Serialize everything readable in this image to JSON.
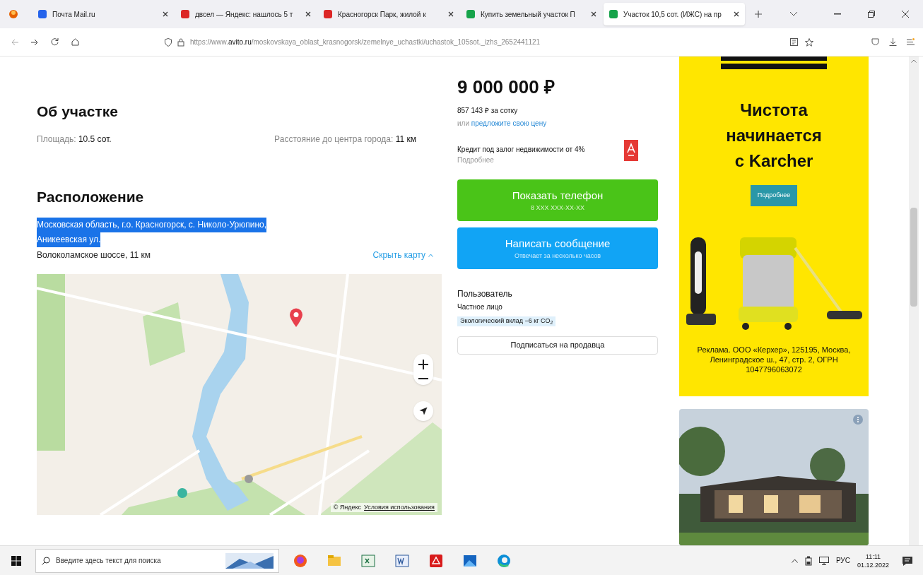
{
  "browser": {
    "tabs": [
      {
        "title": "Почта Mail.ru",
        "selected": false,
        "color": "#2563eb"
      },
      {
        "title": "двсел — Яндекс: нашлось 5 т",
        "selected": false,
        "color": "#dc2626"
      },
      {
        "title": "Красногорск Парк, жилой к",
        "selected": false,
        "color": "#dc2626"
      },
      {
        "title": "Купить земельный участок П",
        "selected": false,
        "color": "#16a34a"
      },
      {
        "title": "Участок 10,5 сот. (ИЖС) на пр",
        "selected": true,
        "color": "#16a34a"
      }
    ],
    "url_prefix": "https://www.",
    "url_domain": "avito.ru",
    "url_path": "/moskovskaya_oblast_krasnogorsk/zemelnye_uchastki/uchastok_105sot._izhs_2652441121"
  },
  "about": {
    "heading": "Об участке",
    "fields": [
      {
        "label": "Площадь:",
        "value": "10.5 сот."
      },
      {
        "label": "Расстояние до центра города:",
        "value": "11 км"
      }
    ]
  },
  "location": {
    "heading": "Расположение",
    "address_lines": [
      "Московская область, г.о. Красногорск, с. Николо-Урюпино,",
      "Аникеевская ул."
    ],
    "address_selected": true,
    "highway": "Волоколамское шоссе, 11 км",
    "hide_map": "Скрыть карту"
  },
  "map": {
    "copyright": "© Яндекс",
    "terms": "Условия использования"
  },
  "offer": {
    "price": "9 000 000 ₽",
    "per_unit": "857 143 ₽ за сотку",
    "offer_prefix": "или",
    "offer_link": "предложите свою цену",
    "promo": {
      "text": "Кредит под залог недвижимости от 4%",
      "more": "Подробнее"
    },
    "buttons": [
      {
        "kind": "phone",
        "title": "Показать телефон",
        "subtitle": "8 XXX XXX-XX-XX"
      },
      {
        "kind": "message",
        "title": "Написать сообщение",
        "subtitle": "Отвечает за несколько часов"
      }
    ],
    "seller": {
      "role": "Пользователь",
      "type": "Частное лицо",
      "eco": "Экологический вклад −6 кг CO$_{2}$"
    },
    "subscribe": "Подписаться на продавца"
  },
  "ad": {
    "headline": [
      "Чистота",
      "начинается",
      "с Karcher"
    ],
    "button": "Подробнее",
    "legal": "Реклама. ООО «Керхер», 125195, Москва, Ленинградское ш., 47, стр. 2, ОГРН 1047796063072"
  },
  "taskbar": {
    "search_placeholder": "Введите здесь текст для поиска",
    "lang": "РУС",
    "time": "11:11",
    "date": "01.12.2022"
  }
}
